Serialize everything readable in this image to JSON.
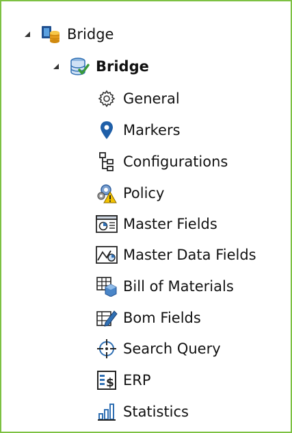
{
  "tree": {
    "root": {
      "label": "Bridge",
      "icon": "database-folder-icon"
    },
    "child": {
      "label": "Bridge",
      "icon": "database-check-icon"
    },
    "items": [
      {
        "label": "General",
        "icon": "gear-icon"
      },
      {
        "label": "Markers",
        "icon": "map-marker-icon"
      },
      {
        "label": "Configurations",
        "icon": "hierarchy-icon"
      },
      {
        "label": "Policy",
        "icon": "policy-warning-icon"
      },
      {
        "label": "Master Fields",
        "icon": "master-fields-icon"
      },
      {
        "label": "Master Data Fields",
        "icon": "master-data-fields-icon"
      },
      {
        "label": "Bill of Materials",
        "icon": "bill-of-materials-icon"
      },
      {
        "label": "Bom Fields",
        "icon": "bom-fields-icon"
      },
      {
        "label": "Search Query",
        "icon": "crosshair-icon"
      },
      {
        "label": "ERP",
        "icon": "erp-icon"
      },
      {
        "label": "Statistics",
        "icon": "statistics-icon"
      }
    ]
  },
  "colors": {
    "border": "#7dc142",
    "accent_blue": "#2f6fb3",
    "check_green": "#3a9a3a",
    "warning_yellow": "#f2c200"
  }
}
